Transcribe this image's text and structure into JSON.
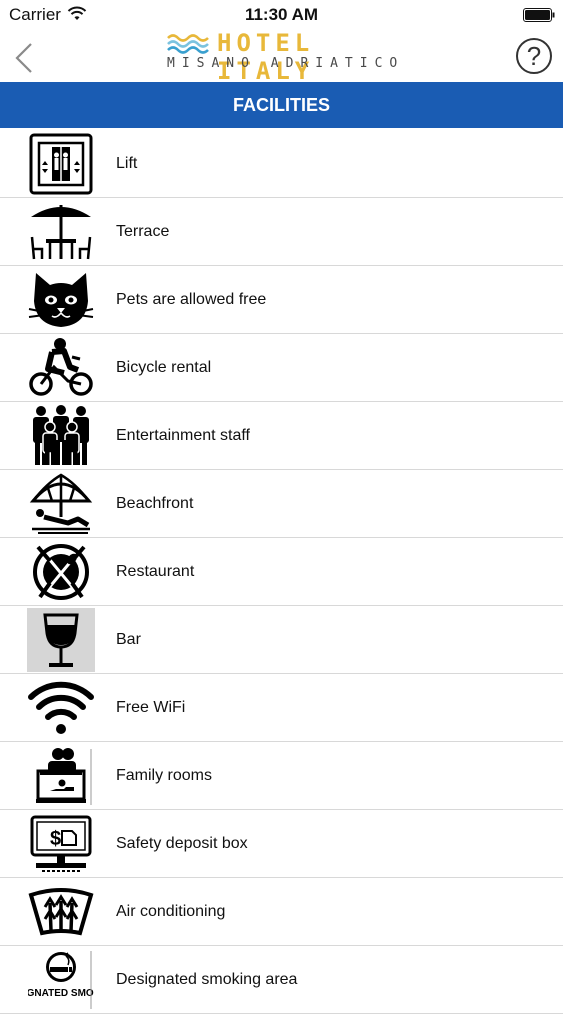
{
  "status_bar": {
    "carrier": "Carrier",
    "time": "11:30 AM",
    "wifi_icon": "wifi-icon",
    "battery_icon": "battery-icon"
  },
  "nav": {
    "back_icon": "chevron-left-icon",
    "logo_title": "HOTEL ITALY",
    "logo_subtitle": "MISANO ADRIATICO",
    "help_label": "?",
    "logo_color": "#e8b83a"
  },
  "header": {
    "title": "FACILITIES",
    "color": "#1a5cb3"
  },
  "facilities": [
    {
      "label": "Lift",
      "icon": "lift-icon"
    },
    {
      "label": "Terrace",
      "icon": "terrace-icon"
    },
    {
      "label": "Pets are allowed free",
      "icon": "cat-icon"
    },
    {
      "label": "Bicycle rental",
      "icon": "bicycle-icon"
    },
    {
      "label": "Entertainment staff",
      "icon": "staff-icon"
    },
    {
      "label": "Beachfront",
      "icon": "beach-umbrella-icon"
    },
    {
      "label": "Restaurant",
      "icon": "restaurant-icon"
    },
    {
      "label": "Bar",
      "icon": "wine-glass-icon"
    },
    {
      "label": "Free WiFi",
      "icon": "wifi-icon"
    },
    {
      "label": "Family rooms",
      "icon": "family-icon"
    },
    {
      "label": "Safety deposit box",
      "icon": "safe-icon"
    },
    {
      "label": "Air conditioning",
      "icon": "air-conditioning-icon"
    },
    {
      "label": "Designated smoking area",
      "icon": "smoking-area-icon",
      "icon_text": "DESIGNATED SMOKING"
    }
  ]
}
